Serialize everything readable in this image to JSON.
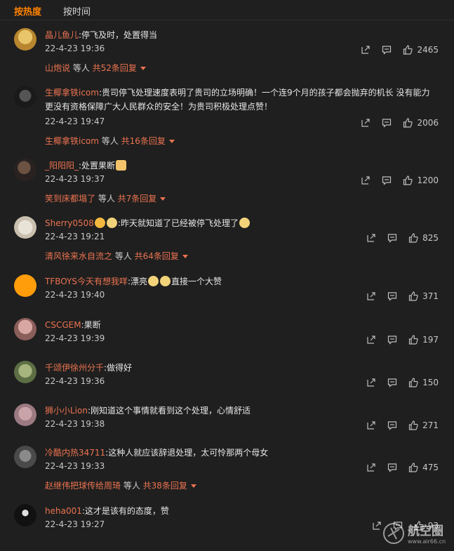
{
  "tabs": {
    "hot": "按热度",
    "time": "按时间"
  },
  "comments": [
    {
      "user": "晶儿鱼儿",
      "text": ":停飞及时，处置得当",
      "text2": "",
      "time": "22-4-23 19:36",
      "likes": "2465",
      "reply_user": "山炮说",
      "reply_mid": " 等人 ",
      "reply_count": "共52条回复"
    },
    {
      "user": "生椰拿铁icom",
      "text": ":贵司停飞处理速度表明了贵司的立场明确！一个连9个月的孩子都会抛弃的机长 没有能力",
      "text2": "更没有资格保障广大人民群众的安全！为贵司积极处理点赞！",
      "time": "22-4-23 19:47",
      "likes": "2006",
      "reply_user": "生椰拿铁icom",
      "reply_mid": " 等人 ",
      "reply_count": "共16条回复"
    },
    {
      "user": "_阳阳阳_",
      "text": ":处置果断",
      "text2": "",
      "time": "22-4-23 19:37",
      "likes": "1200",
      "reply_user": "笑到床都塌了",
      "reply_mid": " 等人 ",
      "reply_count": "共7条回复"
    },
    {
      "user": "Sherry0508",
      "text": ":昨天就知道了已经被停飞处理了",
      "text2": "",
      "time": "22-4-23 19:21",
      "likes": "825",
      "reply_user": "清风徐来水自流之",
      "reply_mid": " 等人 ",
      "reply_count": "共64条回复"
    },
    {
      "user": "TFBOYS今天有想我咩",
      "text": ":漂亮",
      "text_after": "直接一个大赞",
      "text2": "",
      "time": "22-4-23 19:40",
      "likes": "371"
    },
    {
      "user": "CSCGEM",
      "text": ":果断",
      "text2": "",
      "time": "22-4-23 19:39",
      "likes": "197"
    },
    {
      "user": "千颂伊徐州分千",
      "text": ":做得好",
      "text2": "",
      "time": "22-4-23 19:36",
      "likes": "150"
    },
    {
      "user": "狮小小Lion",
      "text": ":刚知道这个事情就看到这个处理，心情舒适",
      "text2": "",
      "time": "22-4-23 19:38",
      "likes": "271"
    },
    {
      "user": "冷酷内热34711",
      "text": ":这种人就应该辞退处理，太可怜那两个母女",
      "text2": "",
      "time": "22-4-23 19:33",
      "likes": "475",
      "reply_user": "赵继伟把球传给周琦",
      "reply_mid": " 等人 ",
      "reply_count": "共38条回复"
    },
    {
      "user": "heha001",
      "text": ":这才是该有的态度，赞",
      "text2": "",
      "time": "22-4-23 19:27",
      "likes": "93"
    }
  ],
  "watermark": {
    "title": "航空圈",
    "url": "www.air66.cn"
  },
  "colors": {
    "accent": "#ff8200",
    "username": "#eb7350",
    "background": "#1f1f1f"
  }
}
